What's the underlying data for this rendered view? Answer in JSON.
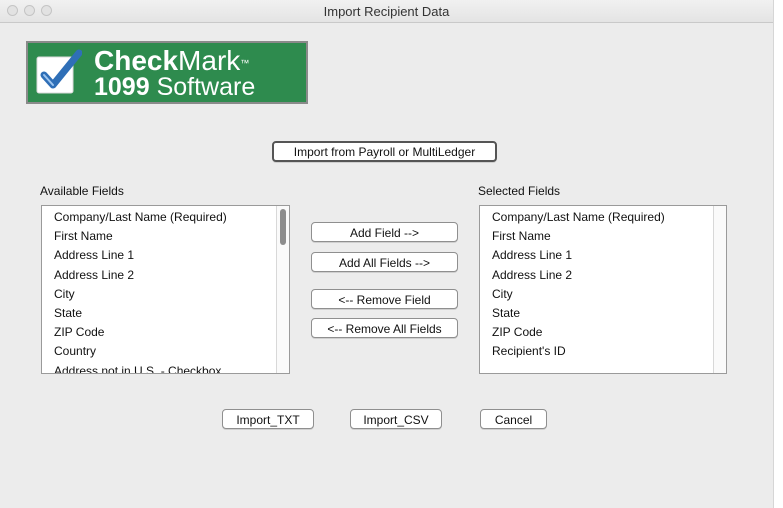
{
  "window": {
    "title": "Import Recipient Data"
  },
  "logo": {
    "line1_bold": "Check",
    "line1_rest": "Mark",
    "tm": "™",
    "line2_bold": "1099",
    "line2_rest": " Software",
    "colors": {
      "background": "#2e8b4e",
      "check": "#2f6fb7"
    }
  },
  "import_payroll_label": "Import from Payroll or MultiLedger",
  "available": {
    "heading": "Available Fields",
    "items": [
      "Company/Last Name (Required)",
      "First Name",
      "Address Line 1",
      "Address Line 2",
      "City",
      "State",
      "ZIP Code",
      "Country",
      "Address not in U.S. - Checkbox"
    ]
  },
  "selected": {
    "heading": "Selected Fields",
    "items": [
      "Company/Last Name (Required)",
      "First Name",
      "Address Line 1",
      "Address Line 2",
      "City",
      "State",
      "ZIP Code",
      "Recipient's ID"
    ]
  },
  "middle_buttons": {
    "add_field": "Add Field -->",
    "add_all": "Add All Fields -->",
    "remove_field": "<-- Remove Field",
    "remove_all": "<-- Remove All Fields"
  },
  "bottom_buttons": {
    "import_txt": "Import_TXT",
    "import_csv": "Import_CSV",
    "cancel": "Cancel"
  }
}
